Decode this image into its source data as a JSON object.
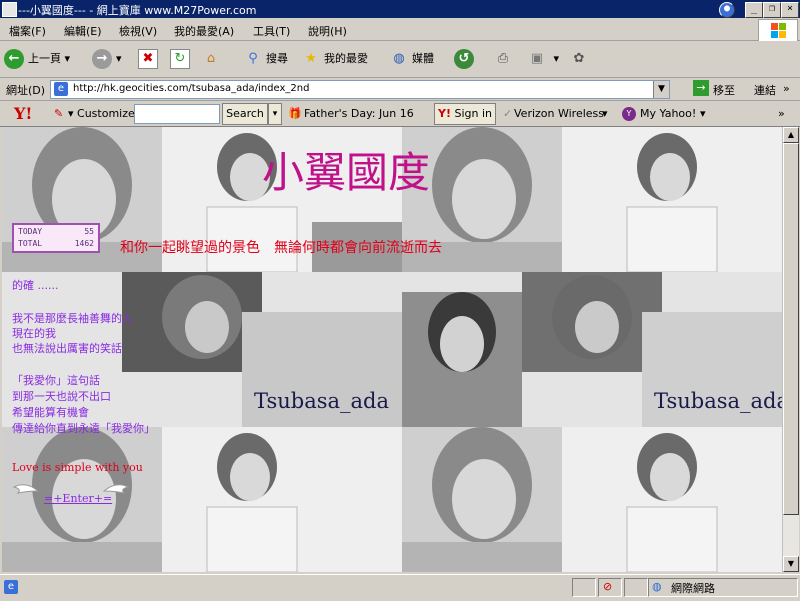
{
  "window": {
    "title": "---小翼國度--- - 網上寶庫 www.M27Power.com"
  },
  "menu": {
    "items": [
      "檔案(F)",
      "編輯(E)",
      "檢視(V)",
      "我的最愛(A)",
      "工具(T)",
      "說明(H)"
    ]
  },
  "toolbar": {
    "back_label": "上一頁",
    "search_label": "搜尋",
    "favorites_label": "我的最愛",
    "media_label": "媒體"
  },
  "address": {
    "label": "網址(D)",
    "url": "http://hk.geocities.com/tsubasa_ada/index_2nd",
    "go_label": "移至",
    "links_label": "連結"
  },
  "yahoo_bar": {
    "customize_label": "Customize",
    "search_button": "Search",
    "fathers_day": "Father's Day: Jun 16",
    "sign_in": "Sign in",
    "verizon": "Verizon Wireless",
    "my_yahoo": "My Yahoo!",
    "more": "»"
  },
  "page": {
    "heading": "小翼國度",
    "counter": {
      "today_label": "TODAY",
      "today_value": "55",
      "total_label": "TOTAL",
      "total_value": "1462"
    },
    "tagline": "和你一起眺望過的景色　無論何時都會向前流逝而去",
    "line_dilu": "的確 ......",
    "poem1": [
      "我不是那麼長袖善舞的人",
      "現在的我",
      "也無法說出厲害的笑話"
    ],
    "poem2": [
      "「我愛你」這句話",
      "到那一天也說不出口",
      "希望能算有機會",
      "傳達給你直到永遠「我愛你」"
    ],
    "love_line": "Love is simple with you",
    "enter_link": "=+Enter+=",
    "watermark1": "Tsubasa_ada",
    "watermark2": "Tsubasa_ada"
  },
  "status": {
    "zone_label": "網際網路"
  },
  "colors": {
    "heading": "#c0108a",
    "tagline": "#e0001a",
    "poem": "#8a2be2",
    "love": "#e0001a",
    "titlebar": "#0a246a"
  }
}
